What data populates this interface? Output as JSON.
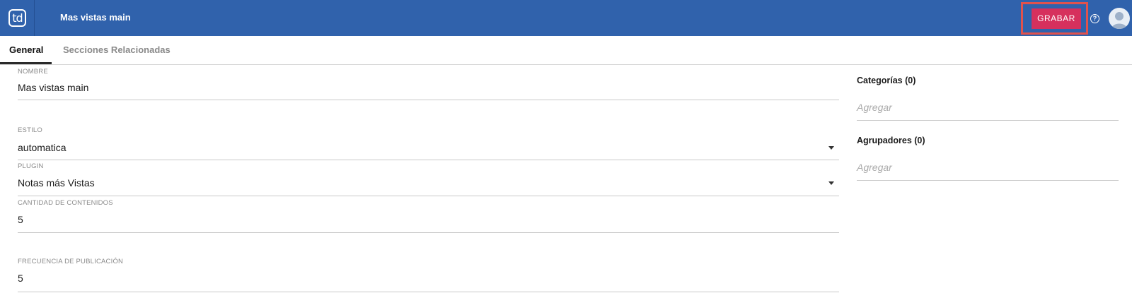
{
  "header": {
    "logo_text": "td",
    "title": "Mas vistas main",
    "save_label": "GRABAR",
    "help_symbol": "?",
    "brand_color": "#3062ac",
    "save_color": "#d6305d"
  },
  "tabs": [
    {
      "label": "General",
      "active": true
    },
    {
      "label": "Secciones Relacionadas",
      "active": false
    }
  ],
  "form": {
    "nombre": {
      "label": "NOMBRE",
      "value": "Mas vistas main"
    },
    "estilo": {
      "label": "ESTILO",
      "value": "automatica"
    },
    "plugin": {
      "label": "PLUGIN",
      "value": "Notas más Vistas"
    },
    "cantidad": {
      "label": "CANTIDAD DE CONTENIDOS",
      "value": "5"
    },
    "frecuencia": {
      "label": "FRECUENCIA DE PUBLICACIÓN",
      "value": "5"
    }
  },
  "sidebar": {
    "categorias": {
      "title": "Categorías (0)",
      "placeholder": "Agregar"
    },
    "agrupadores": {
      "title": "Agrupadores (0)",
      "placeholder": "Agregar"
    }
  },
  "icons": {
    "logo": "td-logo-icon",
    "help": "help-circle-icon",
    "avatar": "user-avatar-icon",
    "dropdown": "caret-down-icon"
  }
}
